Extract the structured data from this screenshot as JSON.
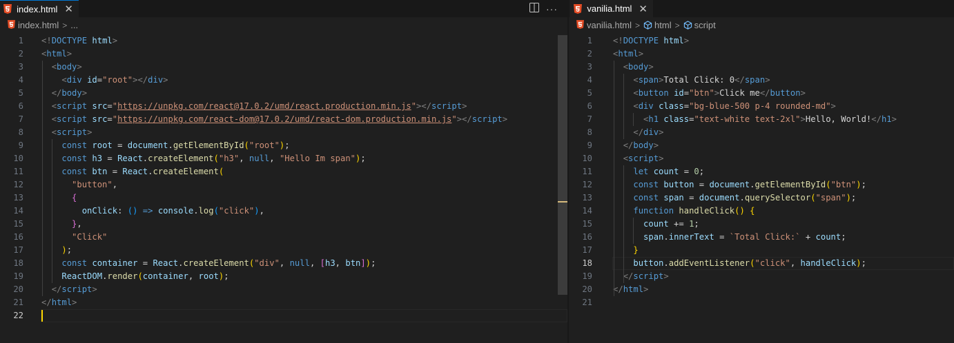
{
  "left": {
    "tab_label": "index.html",
    "breadcrumb": {
      "file": "index.html",
      "more": "..."
    },
    "active_line": 22,
    "lines": [
      [
        [
          "pu",
          "<!"
        ],
        [
          "tg",
          "DOCTYPE"
        ],
        [
          "tx",
          " "
        ],
        [
          "at",
          "html"
        ],
        [
          "pu",
          ">"
        ]
      ],
      [
        [
          "pu",
          "<"
        ],
        [
          "tg",
          "html"
        ],
        [
          "pu",
          ">"
        ]
      ],
      [
        [
          "tx",
          "  "
        ],
        [
          "pu",
          "<"
        ],
        [
          "tg",
          "body"
        ],
        [
          "pu",
          ">"
        ]
      ],
      [
        [
          "tx",
          "    "
        ],
        [
          "pu",
          "<"
        ],
        [
          "tg",
          "div"
        ],
        [
          "tx",
          " "
        ],
        [
          "at",
          "id"
        ],
        [
          "tx",
          "="
        ],
        [
          "st",
          "\"root\""
        ],
        [
          "pu",
          "></"
        ],
        [
          "tg",
          "div"
        ],
        [
          "pu",
          ">"
        ]
      ],
      [
        [
          "tx",
          "  "
        ],
        [
          "pu",
          "</"
        ],
        [
          "tg",
          "body"
        ],
        [
          "pu",
          ">"
        ]
      ],
      [
        [
          "tx",
          "  "
        ],
        [
          "pu",
          "<"
        ],
        [
          "tg",
          "script"
        ],
        [
          "tx",
          " "
        ],
        [
          "at",
          "src"
        ],
        [
          "tx",
          "="
        ],
        [
          "st",
          "\""
        ],
        [
          "st ul",
          "https://unpkg.com/react@17.0.2/umd/react.production.min.js"
        ],
        [
          "st",
          "\""
        ],
        [
          "pu",
          "></"
        ],
        [
          "tg",
          "script"
        ],
        [
          "pu",
          ">"
        ]
      ],
      [
        [
          "tx",
          "  "
        ],
        [
          "pu",
          "<"
        ],
        [
          "tg",
          "script"
        ],
        [
          "tx",
          " "
        ],
        [
          "at",
          "src"
        ],
        [
          "tx",
          "="
        ],
        [
          "st",
          "\""
        ],
        [
          "st ul",
          "https://unpkg.com/react-dom@17.0.2/umd/react-dom.production.min.js"
        ],
        [
          "st",
          "\""
        ],
        [
          "pu",
          "></"
        ],
        [
          "tg",
          "script"
        ],
        [
          "pu",
          ">"
        ]
      ],
      [
        [
          "tx",
          "  "
        ],
        [
          "pu",
          "<"
        ],
        [
          "tg",
          "script"
        ],
        [
          "pu",
          ">"
        ]
      ],
      [
        [
          "tx",
          "    "
        ],
        [
          "kw",
          "const"
        ],
        [
          "tx",
          " "
        ],
        [
          "vr",
          "root"
        ],
        [
          "tx",
          " = "
        ],
        [
          "vr",
          "document"
        ],
        [
          "tx",
          "."
        ],
        [
          "fn",
          "getElementById"
        ],
        [
          "bk1",
          "("
        ],
        [
          "st",
          "\"root\""
        ],
        [
          "bk1",
          ")"
        ],
        [
          "tx",
          ";"
        ]
      ],
      [
        [
          "tx",
          "    "
        ],
        [
          "kw",
          "const"
        ],
        [
          "tx",
          " "
        ],
        [
          "vr",
          "h3"
        ],
        [
          "tx",
          " = "
        ],
        [
          "vr",
          "React"
        ],
        [
          "tx",
          "."
        ],
        [
          "fn",
          "createElement"
        ],
        [
          "bk1",
          "("
        ],
        [
          "st",
          "\"h3\""
        ],
        [
          "tx",
          ", "
        ],
        [
          "kw",
          "null"
        ],
        [
          "tx",
          ", "
        ],
        [
          "st",
          "\"Hello Im span\""
        ],
        [
          "bk1",
          ")"
        ],
        [
          "tx",
          ";"
        ]
      ],
      [
        [
          "tx",
          "    "
        ],
        [
          "kw",
          "const"
        ],
        [
          "tx",
          " "
        ],
        [
          "vr",
          "btn"
        ],
        [
          "tx",
          " = "
        ],
        [
          "vr",
          "React"
        ],
        [
          "tx",
          "."
        ],
        [
          "fn",
          "createElement"
        ],
        [
          "bk1",
          "("
        ]
      ],
      [
        [
          "tx",
          "      "
        ],
        [
          "st",
          "\"button\""
        ],
        [
          "tx",
          ","
        ]
      ],
      [
        [
          "tx",
          "      "
        ],
        [
          "bk2",
          "{"
        ]
      ],
      [
        [
          "tx",
          "        "
        ],
        [
          "vr",
          "onClick"
        ],
        [
          "tx",
          ": "
        ],
        [
          "bk3",
          "()"
        ],
        [
          "tx",
          " "
        ],
        [
          "kw",
          "=>"
        ],
        [
          "tx",
          " "
        ],
        [
          "vr",
          "console"
        ],
        [
          "tx",
          "."
        ],
        [
          "fn",
          "log"
        ],
        [
          "bk3",
          "("
        ],
        [
          "st",
          "\"click\""
        ],
        [
          "bk3",
          ")"
        ],
        [
          "tx",
          ","
        ]
      ],
      [
        [
          "tx",
          "      "
        ],
        [
          "bk2",
          "}"
        ],
        [
          "tx",
          ","
        ]
      ],
      [
        [
          "tx",
          "      "
        ],
        [
          "st",
          "\"Click\""
        ]
      ],
      [
        [
          "tx",
          "    "
        ],
        [
          "bk1",
          ")"
        ],
        [
          "tx",
          ";"
        ]
      ],
      [
        [
          "tx",
          "    "
        ],
        [
          "kw",
          "const"
        ],
        [
          "tx",
          " "
        ],
        [
          "vr",
          "container"
        ],
        [
          "tx",
          " = "
        ],
        [
          "vr",
          "React"
        ],
        [
          "tx",
          "."
        ],
        [
          "fn",
          "createElement"
        ],
        [
          "bk1",
          "("
        ],
        [
          "st",
          "\"div\""
        ],
        [
          "tx",
          ", "
        ],
        [
          "kw",
          "null"
        ],
        [
          "tx",
          ", "
        ],
        [
          "bk2",
          "["
        ],
        [
          "vr",
          "h3"
        ],
        [
          "tx",
          ", "
        ],
        [
          "vr",
          "btn"
        ],
        [
          "bk2",
          "]"
        ],
        [
          "bk1",
          ")"
        ],
        [
          "tx",
          ";"
        ]
      ],
      [
        [
          "tx",
          "    "
        ],
        [
          "vr",
          "ReactDOM"
        ],
        [
          "tx",
          "."
        ],
        [
          "fn",
          "render"
        ],
        [
          "bk1",
          "("
        ],
        [
          "vr",
          "container"
        ],
        [
          "tx",
          ", "
        ],
        [
          "vr",
          "root"
        ],
        [
          "bk1",
          ")"
        ],
        [
          "tx",
          ";"
        ]
      ],
      [
        [
          "tx",
          "  "
        ],
        [
          "pu",
          "</"
        ],
        [
          "tg",
          "script"
        ],
        [
          "pu",
          ">"
        ]
      ],
      [
        [
          "pu",
          "</"
        ],
        [
          "tg",
          "html"
        ],
        [
          "pu",
          ">"
        ]
      ],
      []
    ]
  },
  "right": {
    "tab_label": "vanilia.html",
    "breadcrumb": {
      "file": "vanilia.html",
      "node1": "html",
      "node2": "script"
    },
    "active_line": 18,
    "lines": [
      [
        [
          "pu",
          "<!"
        ],
        [
          "tg",
          "DOCTYPE"
        ],
        [
          "tx",
          " "
        ],
        [
          "at",
          "html"
        ],
        [
          "pu",
          ">"
        ]
      ],
      [
        [
          "pu",
          "<"
        ],
        [
          "tg",
          "html"
        ],
        [
          "pu",
          ">"
        ]
      ],
      [
        [
          "tx",
          "  "
        ],
        [
          "pu",
          "<"
        ],
        [
          "tg",
          "body"
        ],
        [
          "pu",
          ">"
        ]
      ],
      [
        [
          "tx",
          "    "
        ],
        [
          "pu",
          "<"
        ],
        [
          "tg",
          "span"
        ],
        [
          "pu",
          ">"
        ],
        [
          "tx",
          "Total Click: 0"
        ],
        [
          "pu",
          "</"
        ],
        [
          "tg",
          "span"
        ],
        [
          "pu",
          ">"
        ]
      ],
      [
        [
          "tx",
          "    "
        ],
        [
          "pu",
          "<"
        ],
        [
          "tg",
          "button"
        ],
        [
          "tx",
          " "
        ],
        [
          "at",
          "id"
        ],
        [
          "tx",
          "="
        ],
        [
          "st",
          "\"btn\""
        ],
        [
          "pu",
          ">"
        ],
        [
          "tx",
          "Click me"
        ],
        [
          "pu",
          "</"
        ],
        [
          "tg",
          "button"
        ],
        [
          "pu",
          ">"
        ]
      ],
      [
        [
          "tx",
          "    "
        ],
        [
          "pu",
          "<"
        ],
        [
          "tg",
          "div"
        ],
        [
          "tx",
          " "
        ],
        [
          "at",
          "class"
        ],
        [
          "tx",
          "="
        ],
        [
          "st",
          "\"bg-blue-500 p-4 rounded-md\""
        ],
        [
          "pu",
          ">"
        ]
      ],
      [
        [
          "tx",
          "      "
        ],
        [
          "pu",
          "<"
        ],
        [
          "tg",
          "h1"
        ],
        [
          "tx",
          " "
        ],
        [
          "at",
          "class"
        ],
        [
          "tx",
          "="
        ],
        [
          "st",
          "\"text-white text-2xl\""
        ],
        [
          "pu",
          ">"
        ],
        [
          "tx",
          "Hello, World!"
        ],
        [
          "pu",
          "</"
        ],
        [
          "tg",
          "h1"
        ],
        [
          "pu",
          ">"
        ]
      ],
      [
        [
          "tx",
          "    "
        ],
        [
          "pu",
          "</"
        ],
        [
          "tg",
          "div"
        ],
        [
          "pu",
          ">"
        ]
      ],
      [
        [
          "tx",
          "  "
        ],
        [
          "pu",
          "</"
        ],
        [
          "tg",
          "body"
        ],
        [
          "pu",
          ">"
        ]
      ],
      [
        [
          "tx",
          "  "
        ],
        [
          "pu",
          "<"
        ],
        [
          "tg",
          "script"
        ],
        [
          "pu",
          ">"
        ]
      ],
      [
        [
          "tx",
          "    "
        ],
        [
          "kw",
          "let"
        ],
        [
          "tx",
          " "
        ],
        [
          "vr",
          "count"
        ],
        [
          "tx",
          " = "
        ],
        [
          "nm",
          "0"
        ],
        [
          "tx",
          ";"
        ]
      ],
      [
        [
          "tx",
          "    "
        ],
        [
          "kw",
          "const"
        ],
        [
          "tx",
          " "
        ],
        [
          "vr",
          "button"
        ],
        [
          "tx",
          " = "
        ],
        [
          "vr",
          "document"
        ],
        [
          "tx",
          "."
        ],
        [
          "fn",
          "getElementById"
        ],
        [
          "bk1",
          "("
        ],
        [
          "st",
          "\"btn\""
        ],
        [
          "bk1",
          ")"
        ],
        [
          "tx",
          ";"
        ]
      ],
      [
        [
          "tx",
          "    "
        ],
        [
          "kw",
          "const"
        ],
        [
          "tx",
          " "
        ],
        [
          "vr",
          "span"
        ],
        [
          "tx",
          " = "
        ],
        [
          "vr",
          "document"
        ],
        [
          "tx",
          "."
        ],
        [
          "fn",
          "querySelector"
        ],
        [
          "bk1",
          "("
        ],
        [
          "st",
          "\"span\""
        ],
        [
          "bk1",
          ")"
        ],
        [
          "tx",
          ";"
        ]
      ],
      [
        [
          "tx",
          "    "
        ],
        [
          "kw",
          "function"
        ],
        [
          "tx",
          " "
        ],
        [
          "fn",
          "handleClick"
        ],
        [
          "bk1",
          "()"
        ],
        [
          "tx",
          " "
        ],
        [
          "bk1",
          "{"
        ]
      ],
      [
        [
          "tx",
          "      "
        ],
        [
          "vr",
          "count"
        ],
        [
          "tx",
          " += "
        ],
        [
          "nm",
          "1"
        ],
        [
          "tx",
          ";"
        ]
      ],
      [
        [
          "tx",
          "      "
        ],
        [
          "vr",
          "span"
        ],
        [
          "tx",
          "."
        ],
        [
          "vr",
          "innerText"
        ],
        [
          "tx",
          " = "
        ],
        [
          "st",
          "`Total Click:`"
        ],
        [
          "tx",
          " + "
        ],
        [
          "vr",
          "count"
        ],
        [
          "tx",
          ";"
        ]
      ],
      [
        [
          "tx",
          "    "
        ],
        [
          "bk1",
          "}"
        ]
      ],
      [
        [
          "tx",
          "    "
        ],
        [
          "vr",
          "button"
        ],
        [
          "tx",
          "."
        ],
        [
          "fn",
          "addEventListener"
        ],
        [
          "bk1",
          "("
        ],
        [
          "st",
          "\"click\""
        ],
        [
          "tx",
          ", "
        ],
        [
          "vr",
          "handleClick"
        ],
        [
          "bk1",
          ")"
        ],
        [
          "tx",
          ";"
        ]
      ],
      [
        [
          "tx",
          "  "
        ],
        [
          "pu",
          "</"
        ],
        [
          "tg",
          "script"
        ],
        [
          "pu",
          ">"
        ]
      ],
      [
        [
          "pu",
          "</"
        ],
        [
          "tg",
          "html"
        ],
        [
          "pu",
          ">"
        ]
      ],
      []
    ]
  },
  "colors": {
    "background": "#1f1f1f",
    "tabbar": "#181818",
    "tag": "#569cd6",
    "attribute": "#9cdcfe",
    "string": "#ce9178",
    "function": "#dcdcaa",
    "html_icon": "#e44d26",
    "cursor": "#ffd700"
  },
  "icons": {
    "file_type": "html5-icon",
    "split": "split-editor-icon",
    "more": "more-actions-icon",
    "symbol": "symbol-element-icon"
  }
}
